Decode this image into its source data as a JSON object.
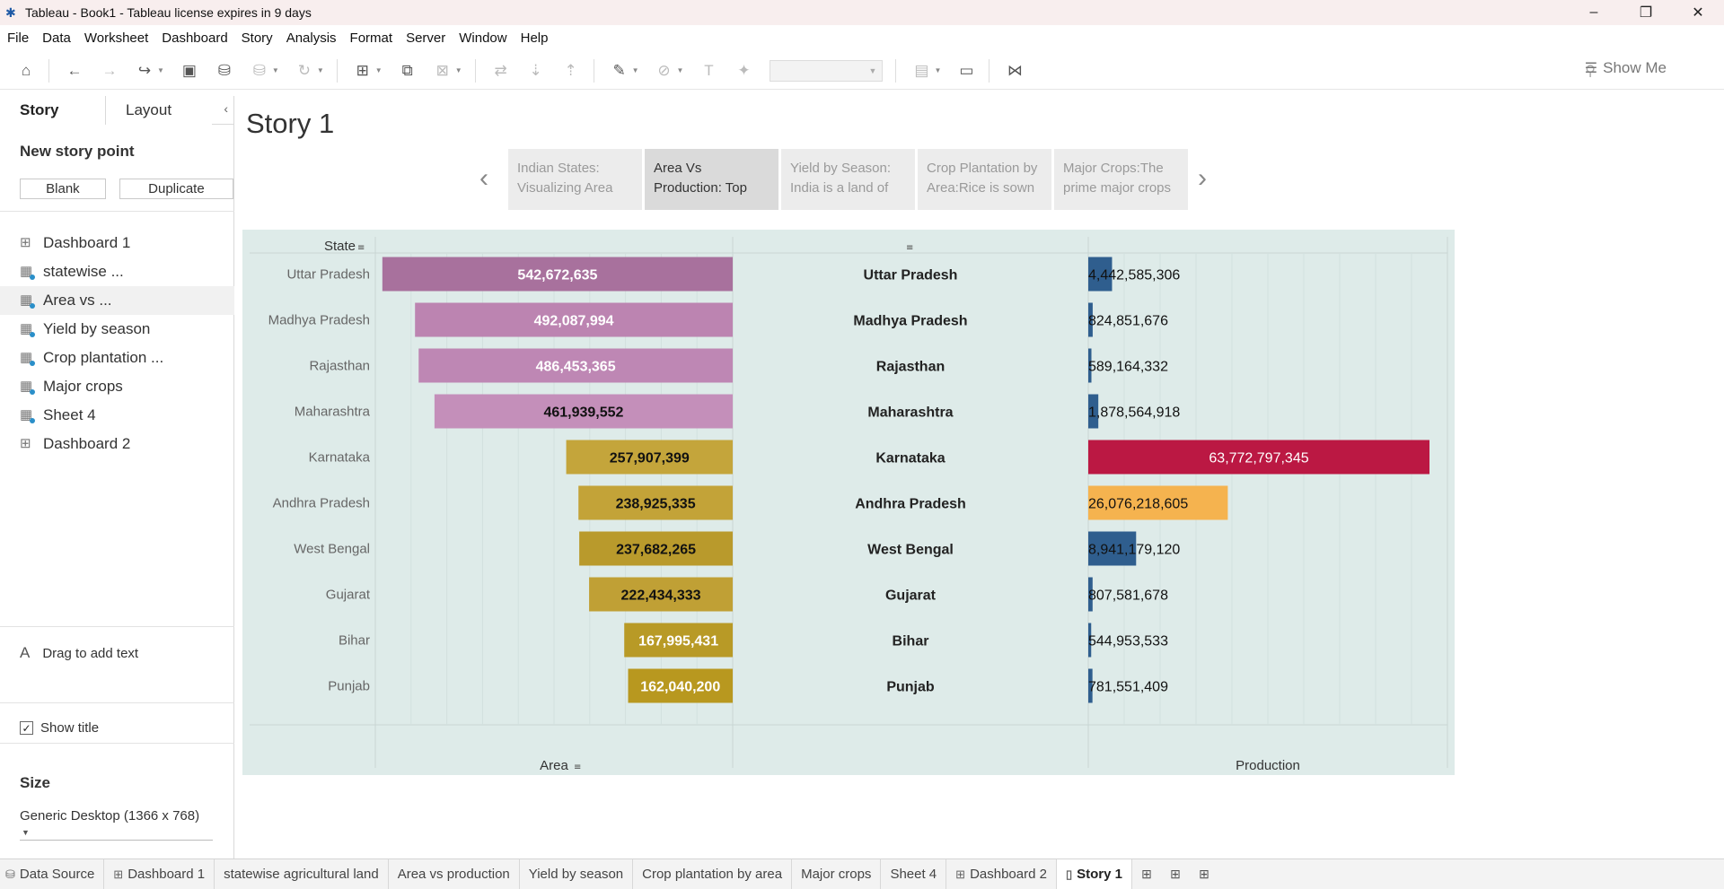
{
  "window": {
    "title": "Tableau - Book1 - Tableau license expires in 9 days",
    "app_icon": "tableau-logo-icon",
    "minimize": "–",
    "restore": "❐",
    "close": "✕"
  },
  "menus": [
    "File",
    "Data",
    "Worksheet",
    "Dashboard",
    "Story",
    "Analysis",
    "Format",
    "Server",
    "Window",
    "Help"
  ],
  "toolbar": {
    "show_me_label": "Show Me"
  },
  "left_panel": {
    "tabs": [
      "Story",
      "Layout"
    ],
    "new_story_point": "New story point",
    "blank_button": "Blank",
    "duplicate_button": "Duplicate",
    "sheets": [
      {
        "label": "Dashboard 1",
        "icon": "dashboard-icon"
      },
      {
        "label": "statewise ...",
        "icon": "worksheet-icon"
      },
      {
        "label": "Area vs ...",
        "icon": "worksheet-icon",
        "selected": true
      },
      {
        "label": "Yield by season",
        "icon": "worksheet-icon"
      },
      {
        "label": "Crop plantation ...",
        "icon": "worksheet-icon"
      },
      {
        "label": "Major crops",
        "icon": "worksheet-icon"
      },
      {
        "label": "Sheet 4",
        "icon": "worksheet-icon"
      },
      {
        "label": "Dashboard 2",
        "icon": "dashboard-icon"
      }
    ],
    "drag_text": "Drag to add text",
    "show_title_label": "Show title",
    "show_title_checked": true,
    "size_heading": "Size",
    "size_value": "Generic Desktop (1366 x 768)"
  },
  "story": {
    "title": "Story 1",
    "points": [
      {
        "line1": "Indian States:",
        "line2": "Visualizing Area",
        "active": false
      },
      {
        "line1": "Area Vs",
        "line2": "Production: Top",
        "active": true
      },
      {
        "line1": "Yield by Season:",
        "line2": "India is a land of",
        "active": false
      },
      {
        "line1": "Crop Plantation by",
        "line2": "Area:Rice is sown",
        "active": false
      },
      {
        "line1": "Major Crops:The",
        "line2": "prime major crops",
        "active": false
      }
    ]
  },
  "chart_data": {
    "type": "bar",
    "row_header": "State",
    "categories": [
      "Uttar Pradesh",
      "Madhya Pradesh",
      "Rajasthan",
      "Maharashtra",
      "Karnataka",
      "Andhra Pradesh",
      "West Bengal",
      "Gujarat",
      "Bihar",
      "Punjab"
    ],
    "series": [
      {
        "name": "Area",
        "values": [
          542672635,
          492087994,
          486453365,
          461939552,
          257907399,
          238925335,
          237682265,
          222434333,
          167995431,
          162040200
        ],
        "labels": [
          "542,672,635",
          "492,087,994",
          "486,453,365",
          "461,939,552",
          "257,907,399",
          "238,925,335",
          "237,682,265",
          "222,434,333",
          "167,995,431",
          "162,040,200"
        ],
        "colors": [
          "#a8719d",
          "#bc84b1",
          "#be87b4",
          "#c48fba",
          "#c4a53b",
          "#c3a338",
          "#b99a2c",
          "#c0a035",
          "#b89a26",
          "#b8981f"
        ],
        "orientation": "right-to-left"
      },
      {
        "name": "Production",
        "values": [
          4442585306,
          824851676,
          589164332,
          1878564918,
          63772797345,
          26076218605,
          8941179120,
          807581678,
          544953533,
          781551409
        ],
        "labels": [
          "4,442,585,306",
          "824,851,676",
          "589,164,332",
          "1,878,564,918",
          "63,772,797,345",
          "26,076,218,605",
          "8,941,179,120",
          "807,581,678",
          "544,953,533",
          "781,551,409"
        ],
        "colors": [
          "#2f5e8e",
          "#2f5e8e",
          "#2f5e8e",
          "#2f5e8e",
          "#bb1843",
          "#f5b34f",
          "#2f5e8e",
          "#2f5e8e",
          "#2f5e8e",
          "#2f5e8e"
        ]
      }
    ],
    "xlabel_left": "Area",
    "xlabel_right": "Production",
    "sorted_fields": [
      "State",
      "Area"
    ],
    "background": "#deebe9"
  },
  "bottom_tabs": [
    {
      "label": "Data Source",
      "icon": "database-icon",
      "kind": "datasource"
    },
    {
      "label": "Dashboard 1",
      "icon": "dashboard-icon",
      "kind": "dashboard"
    },
    {
      "label": "statewise agricultural land",
      "icon": "",
      "kind": "sheet"
    },
    {
      "label": "Area vs production",
      "icon": "",
      "kind": "sheet"
    },
    {
      "label": "Yield by season",
      "icon": "",
      "kind": "sheet"
    },
    {
      "label": "Crop plantation by area",
      "icon": "",
      "kind": "sheet"
    },
    {
      "label": "Major crops",
      "icon": "",
      "kind": "sheet"
    },
    {
      "label": "Sheet 4",
      "icon": "",
      "kind": "sheet"
    },
    {
      "label": "Dashboard 2",
      "icon": "dashboard-icon",
      "kind": "dashboard"
    },
    {
      "label": "Story 1",
      "icon": "story-icon",
      "kind": "story",
      "active": true
    }
  ]
}
